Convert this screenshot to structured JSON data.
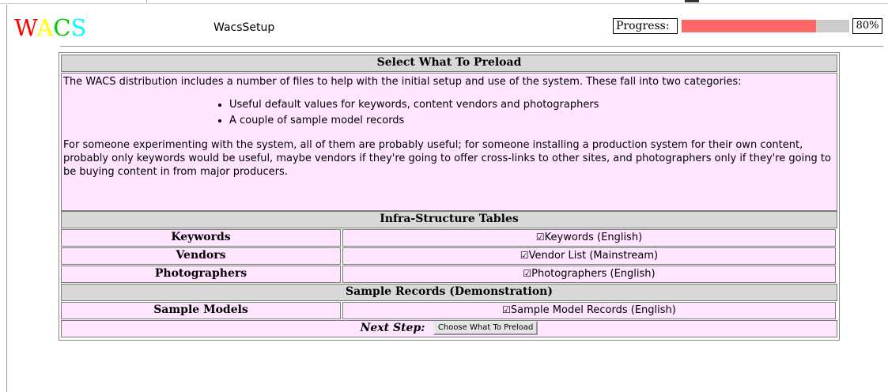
{
  "header": {
    "logo": {
      "letters": [
        "W",
        "A",
        "C",
        "S"
      ],
      "colors": [
        "#ff0000",
        "#ffff00",
        "#00cc00",
        "#00ffff"
      ]
    },
    "app_title": "WacsSetup",
    "progress": {
      "label": "Progress:",
      "percent_text": "80%",
      "value": 80,
      "fill_color": "#ff6666",
      "track_color": "#cccccc"
    }
  },
  "panel": {
    "title": "Select What To Preload",
    "intro": "The WACS distribution includes a number of files to help with the initial setup and use of the system. These fall into two categories:",
    "bullets": [
      "Useful default values for keywords, content vendors and photographers",
      "A couple of sample model records"
    ],
    "conclusion": "For someone experimenting with the system, all of them are probably useful; for someone installing a production system for their own content, probably only keywords would be useful, maybe vendors if they're going to offer cross-links to other sites, and photographers only if they're going to be buying content in from major producers.",
    "section1": {
      "title": "Infra-Structure Tables",
      "rows": [
        {
          "label": "Keywords",
          "option": "Keywords (English)",
          "checked": true
        },
        {
          "label": "Vendors",
          "option": "Vendor List (Mainstream)",
          "checked": true
        },
        {
          "label": "Photographers",
          "option": "Photographers (English)",
          "checked": true
        }
      ]
    },
    "section2": {
      "title": "Sample Records (Demonstration)",
      "rows": [
        {
          "label": "Sample Models",
          "option": "Sample Model Records (English)",
          "checked": true
        }
      ]
    },
    "next": {
      "label": "Next Step:",
      "button": "Choose What To Preload"
    }
  },
  "colors": {
    "pink_bg": "#ffe5ff",
    "header_bg": "#d9d9d9"
  }
}
